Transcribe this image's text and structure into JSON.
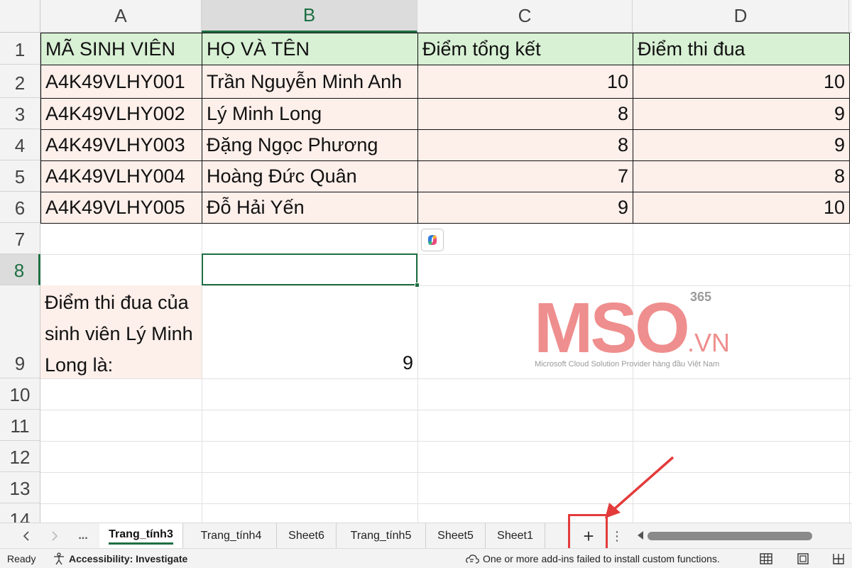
{
  "columns": [
    {
      "letter": "A",
      "selected": false
    },
    {
      "letter": "B",
      "selected": true
    },
    {
      "letter": "C",
      "selected": false
    },
    {
      "letter": "D",
      "selected": false
    }
  ],
  "rows": [
    "1",
    "2",
    "3",
    "4",
    "5",
    "6",
    "7",
    "8",
    "9",
    "10",
    "11",
    "12",
    "13",
    "14"
  ],
  "selected_row": "8",
  "table": {
    "headers": [
      "MÃ SINH VIÊN",
      "HỌ VÀ TÊN",
      "Điểm tổng kết",
      "Điểm thi đua"
    ],
    "records": [
      [
        "A4K49VLHY001",
        "Trần Nguyễn Minh Anh",
        "10",
        "10"
      ],
      [
        "A4K49VLHY002",
        "Lý Minh Long",
        "8",
        "9"
      ],
      [
        "A4K49VLHY003",
        "Đặng Ngọc Phương",
        "8",
        "9"
      ],
      [
        "A4K49VLHY004",
        "Hoàng Đức Quân",
        "7",
        "8"
      ],
      [
        "A4K49VLHY005",
        "Đỗ Hải Yến",
        "9",
        "10"
      ]
    ]
  },
  "note": {
    "label": "Điểm thi đua của sinh viên Lý Minh Long là:",
    "result": "9"
  },
  "watermark": {
    "logo": "MSO",
    "superscript": "365",
    "domain": ".VN",
    "tagline": "Microsoft Cloud Solution Provider hàng đầu Việt Nam"
  },
  "sheet_tabs": {
    "more": "...",
    "tabs": [
      "Trang_tính3",
      "Trang_tính4",
      "Sheet6",
      "Trang_tính5",
      "Sheet5",
      "Sheet1"
    ],
    "active_index": 0,
    "add_label": "+"
  },
  "status_bar": {
    "ready": "Ready",
    "accessibility": "Accessibility: Investigate",
    "message": "One or more add-ins failed to install custom functions."
  },
  "colors": {
    "accent": "#1e6f43",
    "header_fill": "#d8f0d4",
    "data_fill": "#fdefea",
    "highlight_red": "#e33b3b",
    "watermark_pink": "#ef8e8e"
  },
  "icons": [
    "chevron-left-icon",
    "chevron-right-icon",
    "copilot-icon",
    "accessibility-icon",
    "addin-warning-icon",
    "normal-view-icon",
    "page-layout-view-icon",
    "page-break-view-icon",
    "arrow-annotation"
  ]
}
